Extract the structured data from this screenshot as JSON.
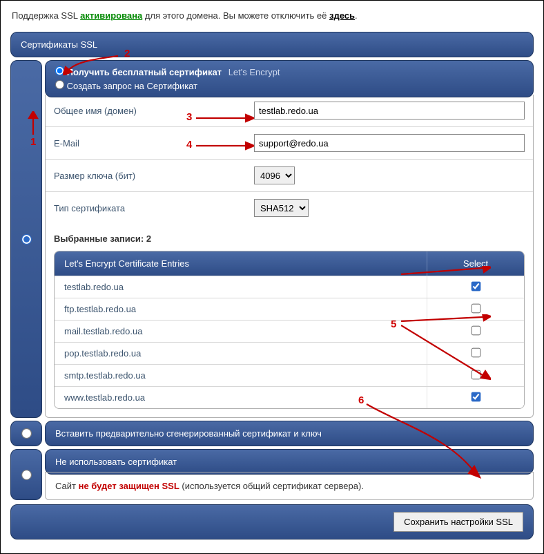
{
  "top": {
    "prefix": "Поддержка SSL ",
    "activated": "активирована",
    "mid": " для этого домена. Вы можете отключить её ",
    "here": "здесь",
    "suffix": "."
  },
  "section_title": "Сертификаты SSL",
  "left_radio_checked": true,
  "options": {
    "get_free": "Получить бесплатный сертификат",
    "get_free_provider": "Let's Encrypt",
    "make_csr": "Создать запрос на Сертификат",
    "get_free_selected": true,
    "make_csr_selected": false
  },
  "fields": {
    "common_name_label": "Общее имя (домен)",
    "common_name_value": "testlab.redo.ua",
    "email_label": "E-Mail",
    "email_value": "support@redo.ua",
    "keysize_label": "Размер ключа (бит)",
    "keysize_value": "4096",
    "certtype_label": "Тип сертификата",
    "certtype_value": "SHA512"
  },
  "selected_entries_label": "Выбранные записи: 2",
  "entries_header": {
    "a": "Let's Encrypt Certificate Entries",
    "b": "Select"
  },
  "entries": [
    {
      "name": "testlab.redo.ua",
      "checked": true
    },
    {
      "name": "ftp.testlab.redo.ua",
      "checked": false
    },
    {
      "name": "mail.testlab.redo.ua",
      "checked": false
    },
    {
      "name": "pop.testlab.redo.ua",
      "checked": false
    },
    {
      "name": "smtp.testlab.redo.ua",
      "checked": false
    },
    {
      "name": "www.testlab.redo.ua",
      "checked": true
    }
  ],
  "alt": {
    "insert_pregen": "Вставить предварительно сгенерированный сертификат и ключ",
    "no_cert": "Не использовать сертификат",
    "insert_pregen_selected": false,
    "no_cert_selected": false
  },
  "warn": {
    "prefix": "Сайт ",
    "red": "не будет защищен SSL",
    "suffix": " (используется общий сертификат сервера)."
  },
  "save_button": "Сохранить настройки SSL",
  "annotations": [
    "1",
    "2",
    "3",
    "4",
    "5",
    "6"
  ]
}
